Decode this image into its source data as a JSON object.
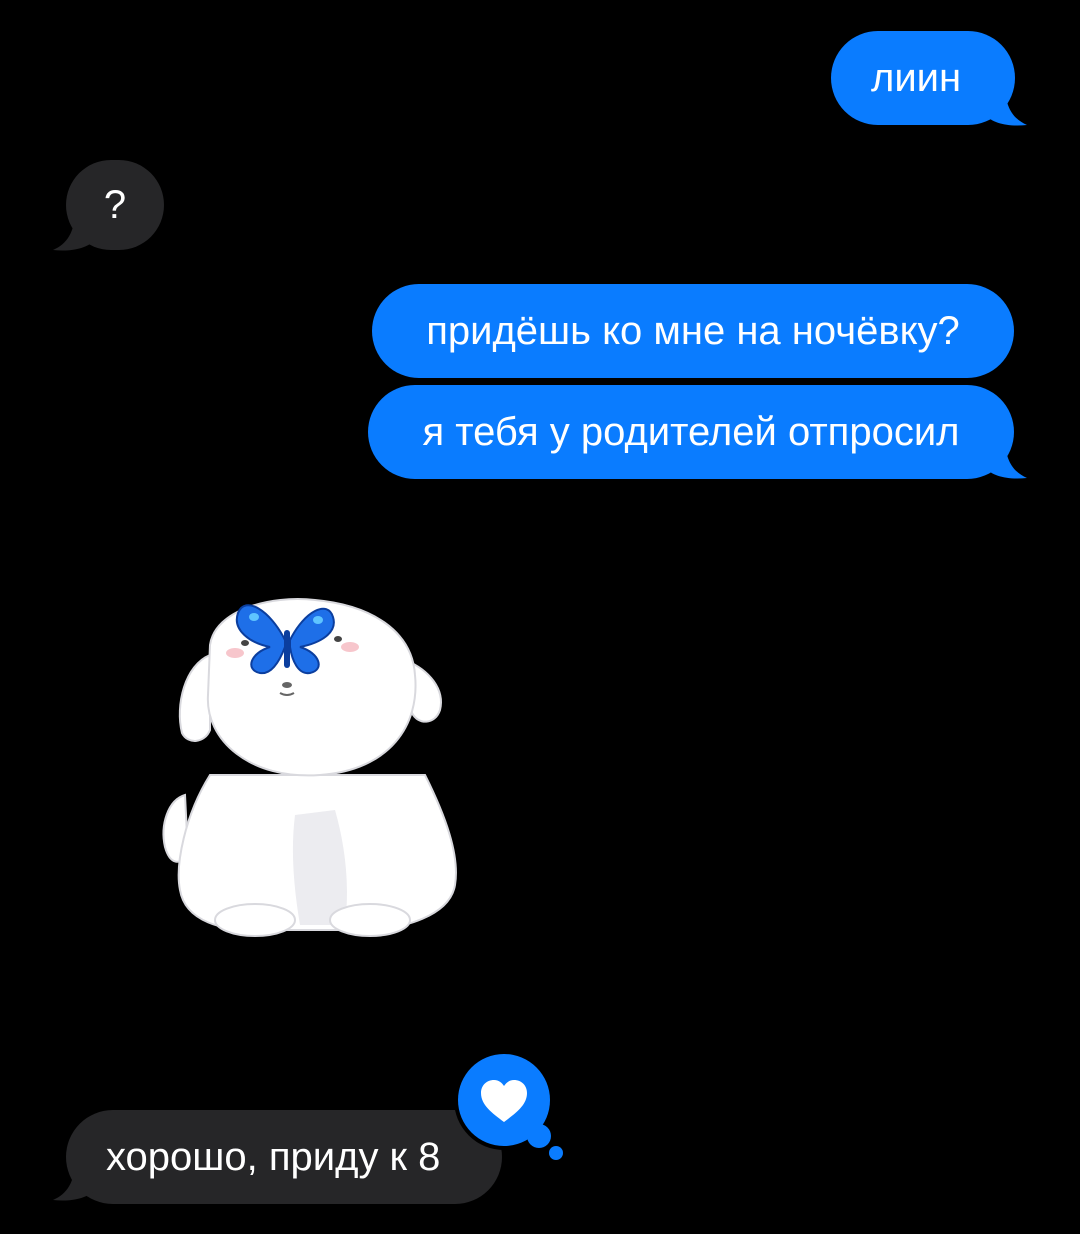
{
  "colors": {
    "outgoing_bubble": "#0a7cff",
    "incoming_bubble": "#262628",
    "background": "#000000",
    "text": "#ffffff"
  },
  "messages": [
    {
      "direction": "outgoing",
      "text": "лиин"
    },
    {
      "direction": "incoming",
      "text": "?"
    },
    {
      "direction": "outgoing",
      "text": "придёшь ко мне на ночёвку?"
    },
    {
      "direction": "outgoing",
      "text": "я тебя у родителей отпросил"
    },
    {
      "direction": "incoming",
      "type": "sticker",
      "sticker": "white-puppy-with-blue-butterfly"
    },
    {
      "direction": "incoming",
      "text": "хорошо, приду к 8",
      "reaction": "heart-icon"
    }
  ]
}
